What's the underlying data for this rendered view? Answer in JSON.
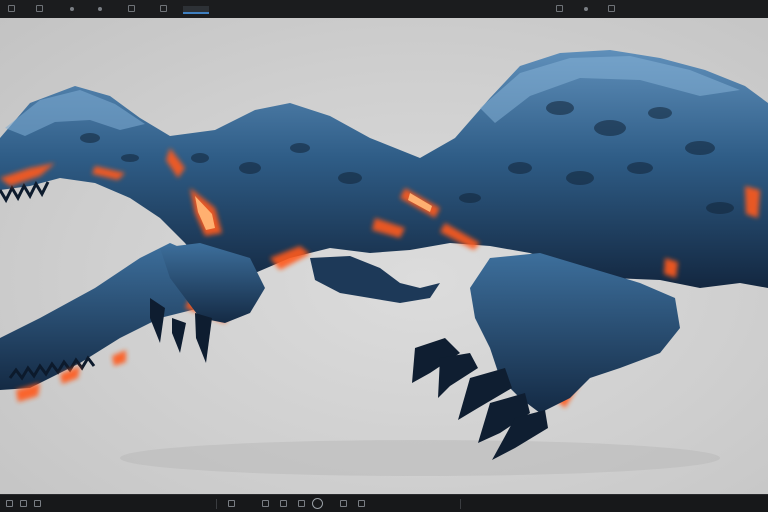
{
  "app": {
    "viewport_background": "#cfcfcf",
    "toolbar_color": "#1b1c1e",
    "accent": "#3f7fbf"
  },
  "toolbar": {
    "icons": [
      "window-icon",
      "menu-icon",
      "view-icon",
      "shading-icon",
      "render-icon",
      "camera-icon",
      "settings-icon",
      "layout-icon"
    ]
  },
  "viewport": {
    "subject": "blue-armored-creature-model",
    "colors": {
      "skin": "#2f5d87",
      "skin_dark": "#172e48",
      "skin_light": "#6f9ec6",
      "glow": "#ff5a1a"
    }
  },
  "timeline": {
    "icons": [
      "play-icon",
      "record-icon",
      "keyframe-icon",
      "loop-icon",
      "step-icon",
      "audio-icon",
      "end-icon"
    ]
  }
}
